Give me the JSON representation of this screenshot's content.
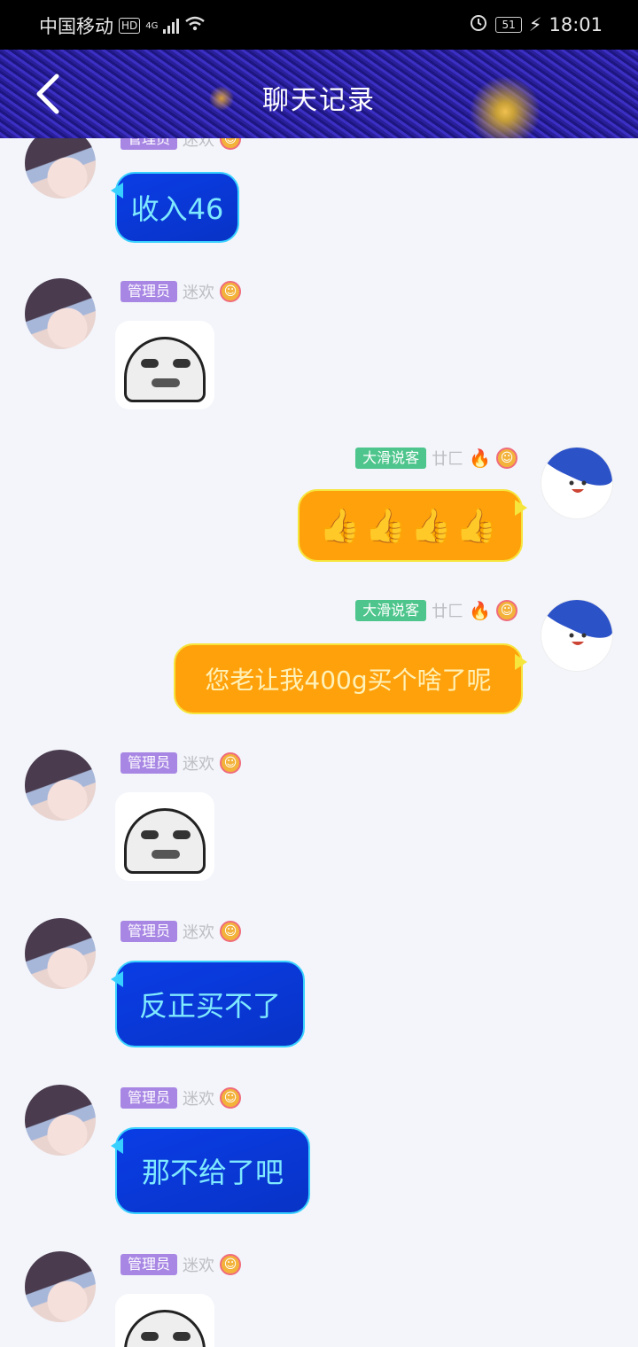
{
  "status_bar": {
    "carrier": "中国移动",
    "hd_label": "HD",
    "network": "4G",
    "battery": "51",
    "time": "18:01"
  },
  "header": {
    "title": "聊天记录"
  },
  "messages": [
    {
      "sender": "管理员",
      "nick": "迷欢",
      "type": "text",
      "text": "收入46"
    },
    {
      "sender": "管理员",
      "nick": "迷欢",
      "type": "sticker"
    },
    {
      "sender": "大滑说客",
      "nick": "廿匚",
      "type": "text",
      "text": "👍👍👍👍"
    },
    {
      "sender": "大滑说客",
      "nick": "廿匚",
      "type": "text",
      "text": "您老让我400g买个啥了呢"
    },
    {
      "sender": "管理员",
      "nick": "迷欢",
      "type": "sticker"
    },
    {
      "sender": "管理员",
      "nick": "迷欢",
      "type": "text",
      "text": "反正买不了"
    },
    {
      "sender": "管理员",
      "nick": "迷欢",
      "type": "text",
      "text": "那不给了吧"
    },
    {
      "sender": "管理员",
      "nick": "迷欢",
      "type": "sticker"
    }
  ],
  "colors": {
    "incoming_bubble": "#0a3de6",
    "outgoing_bubble": "#ffa10b",
    "admin_tag": "#a887e4",
    "user_tag": "#4ec58c"
  }
}
